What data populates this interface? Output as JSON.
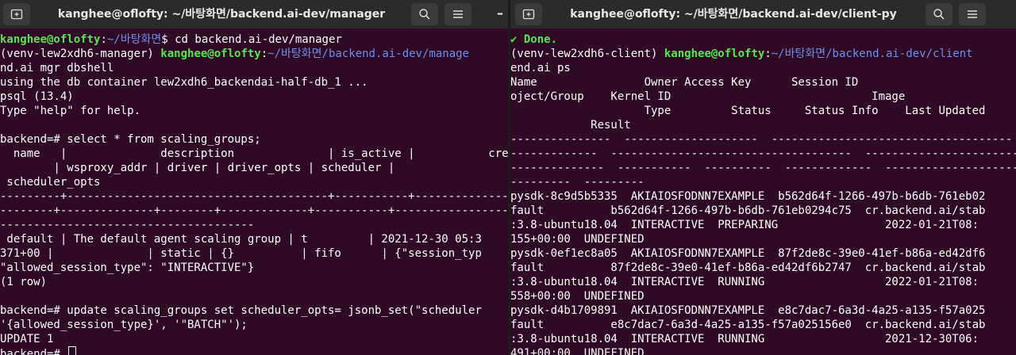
{
  "left_window": {
    "title": "kanghee@oflofty: ~/바탕화면/backend.ai-dev/manager",
    "lines": [
      [
        {
          "t": "kanghee@oflofty",
          "c": "g"
        },
        {
          "t": ":",
          "c": "w"
        },
        {
          "t": "~/바탕화면",
          "c": "b"
        },
        {
          "t": "$ cd backend.ai-dev/manager",
          "c": "w"
        }
      ],
      [
        {
          "t": "(venv-lew2xdh6-manager) ",
          "c": "w"
        },
        {
          "t": "kanghee@oflofty",
          "c": "g"
        },
        {
          "t": ":",
          "c": "w"
        },
        {
          "t": "~/바탕화면/backend.ai-dev/manage",
          "c": "b"
        }
      ],
      [
        {
          "t": "nd.ai mgr dbshell",
          "c": "w"
        }
      ],
      [
        {
          "t": "using the db container lew2xdh6_backendai-half-db_1 ...",
          "c": "w"
        }
      ],
      [
        {
          "t": "psql (13.4)",
          "c": "w"
        }
      ],
      [
        {
          "t": "Type \"help\" for help.",
          "c": "w"
        }
      ],
      [],
      [
        {
          "t": "backend=# select * from scaling_groups;",
          "c": "w"
        }
      ],
      [
        {
          "t": "  name   |              description              | is_active |           create",
          "c": "w"
        }
      ],
      [
        {
          "t": "        | wsproxy_addr | driver | driver_opts | scheduler |",
          "c": "w"
        }
      ],
      [
        {
          "t": " scheduler_opts",
          "c": "w"
        }
      ],
      [
        {
          "t": "---------+---------------------------------------+-----------+----------------",
          "c": "w"
        }
      ],
      [
        {
          "t": "--------+--------------+--------+-------------+-----------+--------------------",
          "c": "w"
        }
      ],
      [
        {
          "t": "--------------------------------------",
          "c": "w"
        }
      ],
      [
        {
          "t": " default | The default agent scaling group | t         | 2021-12-30 05:3",
          "c": "w"
        }
      ],
      [
        {
          "t": "371+00 |              | static | {}          | fifo      | {\"session_typ",
          "c": "w"
        }
      ],
      [
        {
          "t": "\"allowed_session_type\": \"INTERACTIVE\"}",
          "c": "w"
        }
      ],
      [
        {
          "t": "(1 row)",
          "c": "w"
        }
      ],
      [],
      [
        {
          "t": "backend=# update scaling_groups set scheduler_opts= jsonb_set(\"scheduler",
          "c": "w"
        }
      ],
      [
        {
          "t": "'{allowed_session_type}', '\"BATCH\"');",
          "c": "w"
        }
      ],
      [
        {
          "t": "UPDATE 1",
          "c": "w"
        }
      ],
      [
        {
          "t": "backend=# ",
          "c": "w"
        }
      ]
    ]
  },
  "right_window": {
    "title": "kanghee@oflofty: ~/바탕화면/backend.ai-dev/client-py",
    "lines": [
      [
        {
          "t": "✔ Done.",
          "c": "g"
        }
      ],
      [
        {
          "t": "(venv-lew2xdh6-client) ",
          "c": "w"
        },
        {
          "t": "kanghee@oflofty",
          "c": "g"
        },
        {
          "t": ":",
          "c": "w"
        },
        {
          "t": "~/바탕화면/backend.ai-dev/client",
          "c": "b"
        }
      ],
      [
        {
          "t": "end.ai ps",
          "c": "w"
        }
      ],
      [
        {
          "t": "Name                Owner Access Key      Session ID",
          "c": "w"
        }
      ],
      [
        {
          "t": "oject/Group    Kernel ID                              Image",
          "c": "w"
        }
      ],
      [
        {
          "t": "                    Type         Status     Status Info    Last Updated",
          "c": "w"
        }
      ],
      [
        {
          "t": "            Result",
          "c": "w"
        }
      ],
      [
        {
          "t": "---------------  --------------------  ------------------------------------",
          "c": "w"
        }
      ],
      [
        {
          "t": "-------------  ------------------------------------  --------------------------",
          "c": "w"
        }
      ],
      [
        {
          "t": "--------------  -----------  ----------  -------------  ---------------------",
          "c": "w"
        }
      ],
      [
        {
          "t": "---------  ---------",
          "c": "w"
        }
      ],
      [
        {
          "t": "pysdk-8c9d5b5335  AKIAIOSFODNN7EXAMPLE  b562d64f-1266-497b-b6db-761eb02",
          "c": "w"
        }
      ],
      [
        {
          "t": "fault          b562d64f-1266-497b-b6db-761eb0294c75  cr.backend.ai/stab",
          "c": "w"
        }
      ],
      [
        {
          "t": ":3.8-ubuntu18.04  INTERACTIVE  PREPARING                2022-01-21T08:",
          "c": "w"
        }
      ],
      [
        {
          "t": "155+00:00  UNDEFINED",
          "c": "w"
        }
      ],
      [
        {
          "t": "pysdk-0ef1ec8a05  AKIAIOSFODNN7EXAMPLE  87f2de8c-39e0-41ef-b86a-ed42df6",
          "c": "w"
        }
      ],
      [
        {
          "t": "fault          87f2de8c-39e0-41ef-b86a-ed42df6b2747  cr.backend.ai/stab",
          "c": "w"
        }
      ],
      [
        {
          "t": ":3.8-ubuntu18.04  INTERACTIVE  RUNNING                  2022-01-21T08:",
          "c": "w"
        }
      ],
      [
        {
          "t": "558+00:00  UNDEFINED",
          "c": "w"
        }
      ],
      [
        {
          "t": "pysdk-d4b1709891  AKIAIOSFODNN7EXAMPLE  e8c7dac7-6a3d-4a25-a135-f57a025",
          "c": "w"
        }
      ],
      [
        {
          "t": "fault          e8c7dac7-6a3d-4a25-a135-f57a025156e0  cr.backend.ai/stab",
          "c": "w"
        }
      ],
      [
        {
          "t": ":3.8-ubuntu18.04  INTERACTIVE  RUNNING                  2021-12-30T06:",
          "c": "w"
        }
      ],
      [
        {
          "t": "491+00:00  UNDEFINED",
          "c": "w"
        }
      ]
    ]
  },
  "colors": {
    "terminal_bg": "#300a24",
    "titlebar_bg": "#2b2b2b",
    "prompt_user": "#4ee94e",
    "prompt_path": "#6a8ff0",
    "text": "#ffffff"
  },
  "icons": {
    "new_tab": "new-tab-icon",
    "search": "search-icon",
    "menu": "hamburger-menu-icon",
    "minimize": "minimize-icon",
    "minimize_glyph": "–"
  }
}
